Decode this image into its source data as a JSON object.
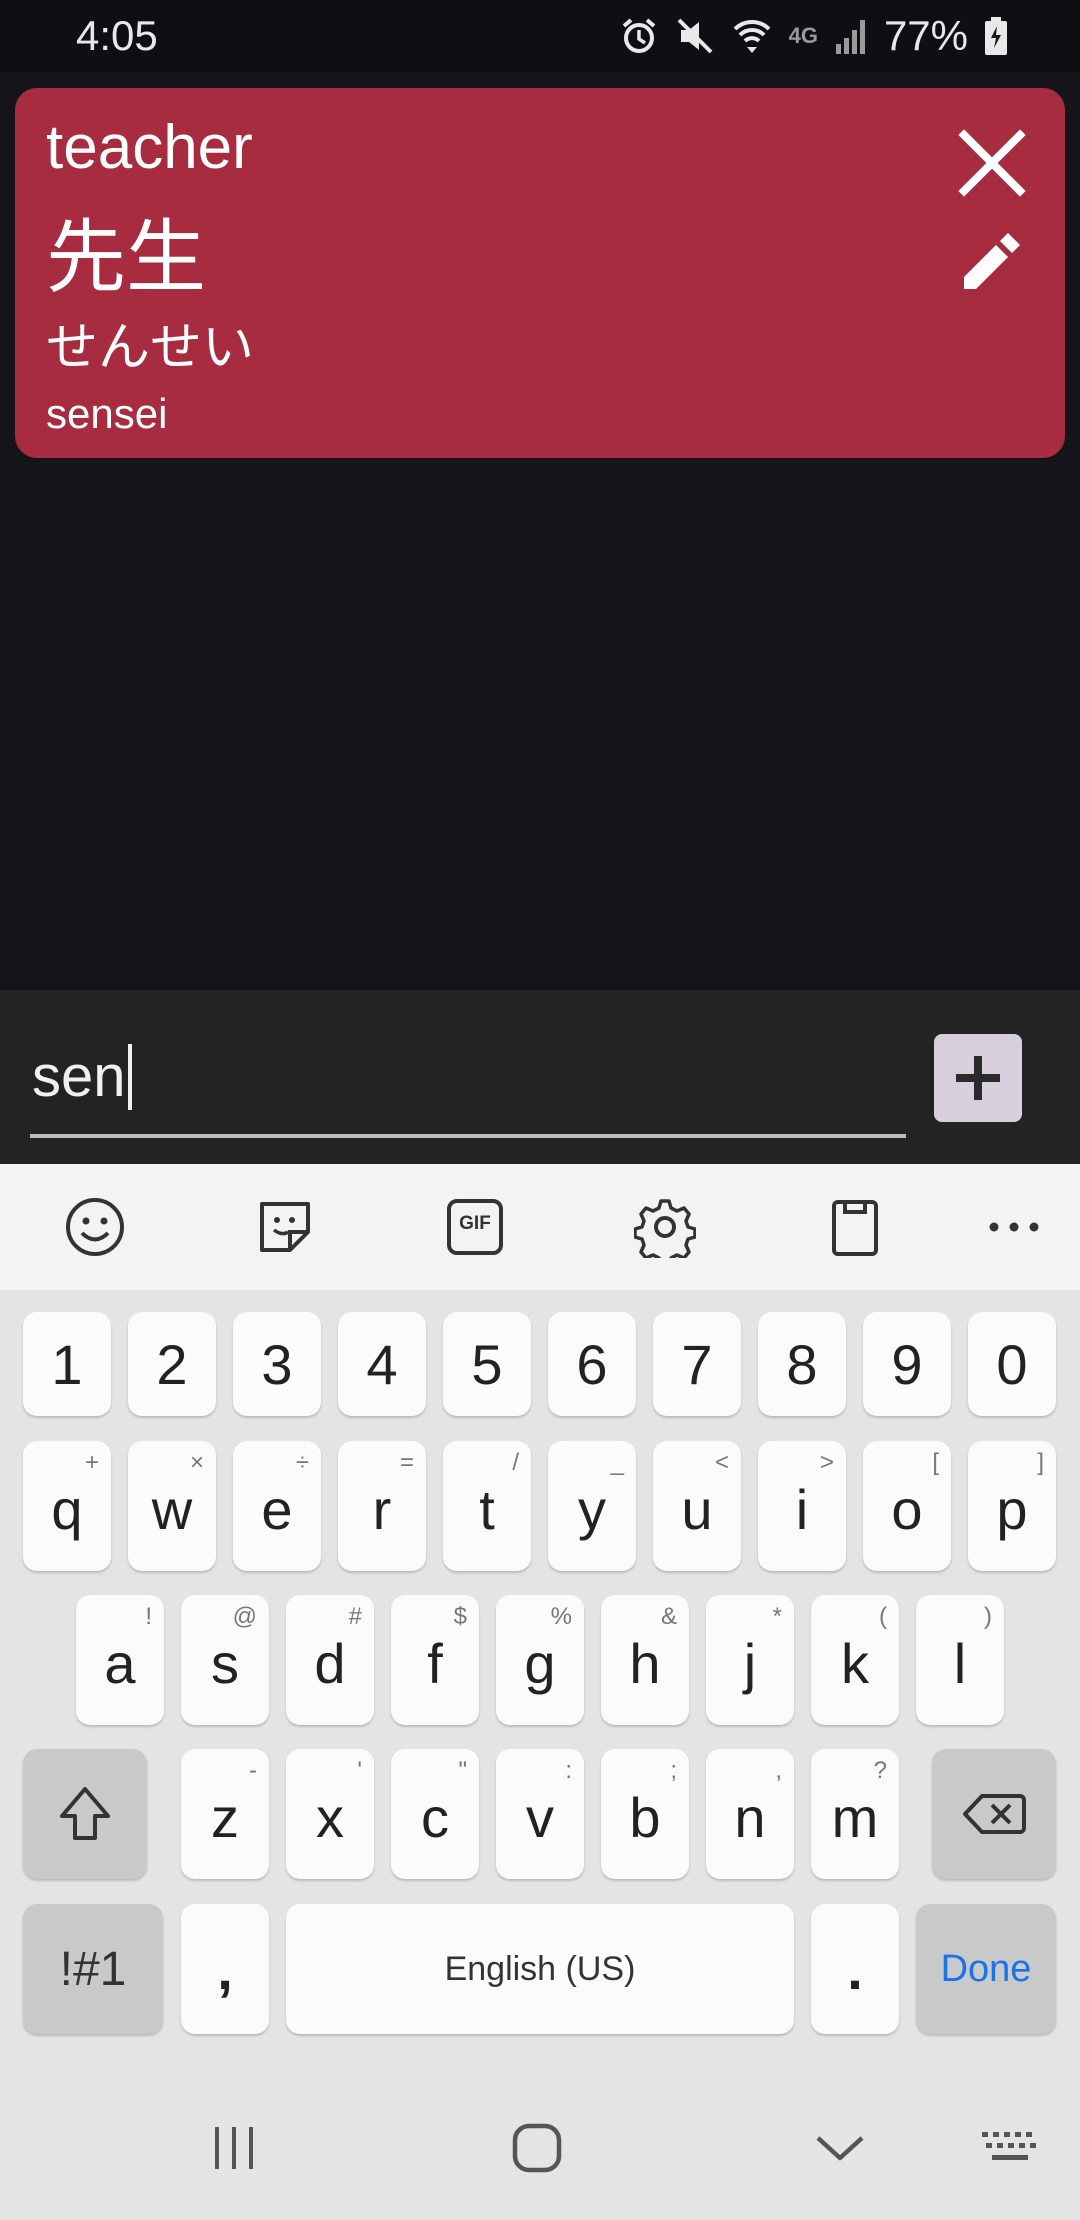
{
  "status_bar": {
    "time": "4:05",
    "network": "4G",
    "battery": "77%",
    "icons": [
      "alarm-icon",
      "mute-icon",
      "wifi-icon",
      "signal-icon",
      "battery-charging-icon"
    ]
  },
  "card": {
    "english": "teacher",
    "kanji": "先生",
    "kana": "せんせい",
    "romaji": "sensei",
    "background_color": "#a82c3f"
  },
  "input": {
    "value": "sen",
    "add_icon": "plus-icon"
  },
  "keyboard": {
    "toolbar": [
      "emoji-icon",
      "sticker-icon",
      "gif-icon",
      "settings-icon",
      "clipboard-icon",
      "more-icon"
    ],
    "gif_label": "GIF",
    "number_row": [
      "1",
      "2",
      "3",
      "4",
      "5",
      "6",
      "7",
      "8",
      "9",
      "0"
    ],
    "row1": [
      {
        "main": "q",
        "sub": "+"
      },
      {
        "main": "w",
        "sub": "×"
      },
      {
        "main": "e",
        "sub": "÷"
      },
      {
        "main": "r",
        "sub": "="
      },
      {
        "main": "t",
        "sub": "/"
      },
      {
        "main": "y",
        "sub": "_"
      },
      {
        "main": "u",
        "sub": "<"
      },
      {
        "main": "i",
        "sub": ">"
      },
      {
        "main": "o",
        "sub": "["
      },
      {
        "main": "p",
        "sub": "]"
      }
    ],
    "row2": [
      {
        "main": "a",
        "sub": "!"
      },
      {
        "main": "s",
        "sub": "@"
      },
      {
        "main": "d",
        "sub": "#"
      },
      {
        "main": "f",
        "sub": "$"
      },
      {
        "main": "g",
        "sub": "%"
      },
      {
        "main": "h",
        "sub": "&"
      },
      {
        "main": "j",
        "sub": "*"
      },
      {
        "main": "k",
        "sub": "("
      },
      {
        "main": "l",
        "sub": ")"
      }
    ],
    "row3": [
      {
        "main": "z",
        "sub": "-"
      },
      {
        "main": "x",
        "sub": "'"
      },
      {
        "main": "c",
        "sub": "\""
      },
      {
        "main": "v",
        "sub": ":"
      },
      {
        "main": "b",
        "sub": ";"
      },
      {
        "main": "n",
        "sub": ","
      },
      {
        "main": "m",
        "sub": "?"
      }
    ],
    "symbols_label": "!#1",
    "comma_label": ",",
    "space_label": "English (US)",
    "period_label": ".",
    "done_label": "Done",
    "done_color": "#1a73e8"
  },
  "nav_bar": [
    "recents-icon",
    "home-icon",
    "back-icon",
    "keyboard-icon"
  ]
}
